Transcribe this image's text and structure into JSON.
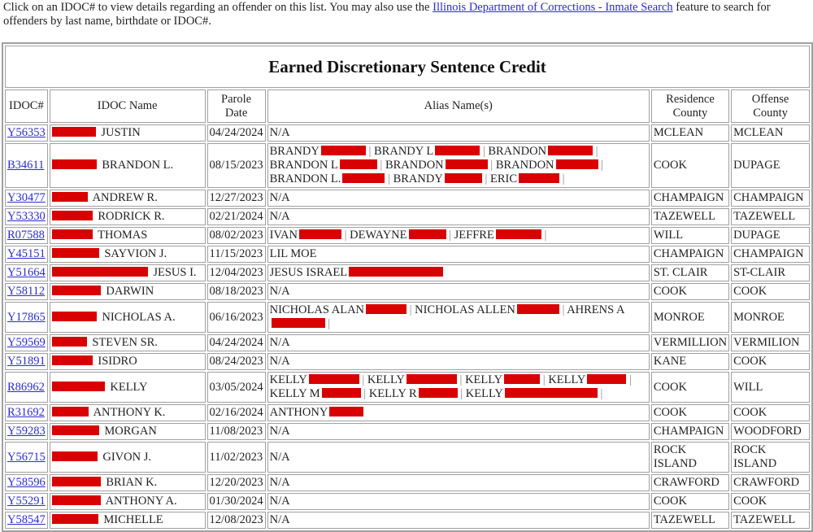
{
  "intro": {
    "text_before": "Click on an IDOC# to view details regarding an offender on this list. You may also use the ",
    "link_text": "Illinois Department of Corrections - Inmate Search",
    "text_after": " feature to search for offenders by last name, birthdate or IDOC#."
  },
  "table": {
    "title": "Earned Discretionary Sentence Credit",
    "headers": [
      "IDOC#",
      "IDOC Name",
      "Parole Date",
      "Alias Name(s)",
      "Residence County",
      "Offense County"
    ],
    "redaction_color": "#d80000",
    "rows": [
      {
        "idoc": "Y56353",
        "name": "JUSTIN",
        "redact_w": 54,
        "date": "04/24/2024",
        "aliases": [],
        "alias_na": "N/A",
        "res": "MCLEAN",
        "off": "MCLEAN"
      },
      {
        "idoc": "B34611",
        "name": "BRANDON L.",
        "redact_w": 55,
        "date": "08/15/2023",
        "aliases": [
          "BRANDY",
          "BRANDY L",
          "BRANDON",
          "BRANDON L",
          "BRANDON",
          "BRANDON",
          "BRANDON L.",
          "BRANDY",
          "ERIC"
        ],
        "alias_na": "",
        "res": "COOK",
        "off": "DUPAGE"
      },
      {
        "idoc": "Y30477",
        "name": "ANDREW R.",
        "redact_w": 44,
        "date": "12/27/2023",
        "aliases": [],
        "alias_na": "N/A",
        "res": "CHAMPAIGN",
        "off": "CHAMPAIGN"
      },
      {
        "idoc": "Y53330",
        "name": "RODRICK R.",
        "redact_w": 50,
        "date": "02/21/2024",
        "aliases": [],
        "alias_na": "N/A",
        "res": "TAZEWELL",
        "off": "TAZEWELL"
      },
      {
        "idoc": "R07588",
        "name": "THOMAS",
        "redact_w": 50,
        "date": "08/02/2023",
        "aliases": [
          "IVAN",
          "DEWAYNE",
          "JEFFRE"
        ],
        "alias_na": "",
        "res": "WILL",
        "off": "DUPAGE"
      },
      {
        "idoc": "Y45151",
        "name": "SAYVION J.",
        "redact_w": 58,
        "date": "11/15/2023",
        "aliases": [],
        "alias_na": "LIL MOE",
        "res": "CHAMPAIGN",
        "off": "CHAMPAIGN"
      },
      {
        "idoc": "Y51664",
        "name": "JESUS I.",
        "redact_w": 118,
        "date": "12/04/2023",
        "aliases": [
          "JESUS ISRAEL"
        ],
        "alias_na": "",
        "res": "ST. CLAIR",
        "off": "ST-CLAIR"
      },
      {
        "idoc": "Y58112",
        "name": "DARWIN",
        "redact_w": 60,
        "date": "08/18/2023",
        "aliases": [],
        "alias_na": "N/A",
        "res": "COOK",
        "off": "COOK"
      },
      {
        "idoc": "Y17865",
        "name": "NICHOLAS A.",
        "redact_w": 55,
        "date": "06/16/2023",
        "aliases": [
          "NICHOLAS ALAN",
          "NICHOLAS ALLEN",
          "AHRENS A"
        ],
        "alias_na": "",
        "res": "MONROE",
        "off": "MONROE"
      },
      {
        "idoc": "Y59569",
        "name": "STEVEN SR.",
        "redact_w": 43,
        "date": "04/24/2024",
        "aliases": [],
        "alias_na": "N/A",
        "res": "VERMILLION",
        "off": "VERMILION"
      },
      {
        "idoc": "Y51891",
        "name": "ISIDRO",
        "redact_w": 50,
        "date": "08/24/2023",
        "aliases": [],
        "alias_na": "N/A",
        "res": "KANE",
        "off": "COOK"
      },
      {
        "idoc": "R86962",
        "name": "KELLY",
        "redact_w": 65,
        "date": "03/05/2024",
        "aliases": [
          "KELLY",
          "KELLY",
          "KELLY",
          "KELLY",
          "KELLY M",
          "KELLY R",
          "KELLY"
        ],
        "alias_na": "",
        "res": "COOK",
        "off": "WILL"
      },
      {
        "idoc": "R31692",
        "name": "ANTHONY K.",
        "redact_w": 45,
        "date": "02/16/2024",
        "aliases": [
          "ANTHONY"
        ],
        "alias_na": "",
        "res": "COOK",
        "off": "COOK"
      },
      {
        "idoc": "Y59283",
        "name": "MORGAN",
        "redact_w": 58,
        "date": "11/08/2023",
        "aliases": [],
        "alias_na": "N/A",
        "res": "CHAMPAIGN",
        "off": "WOODFORD"
      },
      {
        "idoc": "Y56715",
        "name": "GIVON J.",
        "redact_w": 56,
        "date": "11/02/2023",
        "aliases": [],
        "alias_na": "N/A",
        "res": "ROCK ISLAND",
        "off": "ROCK ISLAND"
      },
      {
        "idoc": "Y58596",
        "name": "BRIAN K.",
        "redact_w": 60,
        "date": "12/20/2023",
        "aliases": [],
        "alias_na": "N/A",
        "res": "CRAWFORD",
        "off": "CRAWFORD"
      },
      {
        "idoc": "Y55291",
        "name": "ANTHONY A.",
        "redact_w": 60,
        "date": "01/30/2024",
        "aliases": [],
        "alias_na": "N/A",
        "res": "COOK",
        "off": "COOK"
      },
      {
        "idoc": "Y58547",
        "name": "MICHELLE",
        "redact_w": 57,
        "date": "12/08/2023",
        "aliases": [],
        "alias_na": "N/A",
        "res": "TAZEWELL",
        "off": "TAZEWELL"
      }
    ]
  }
}
